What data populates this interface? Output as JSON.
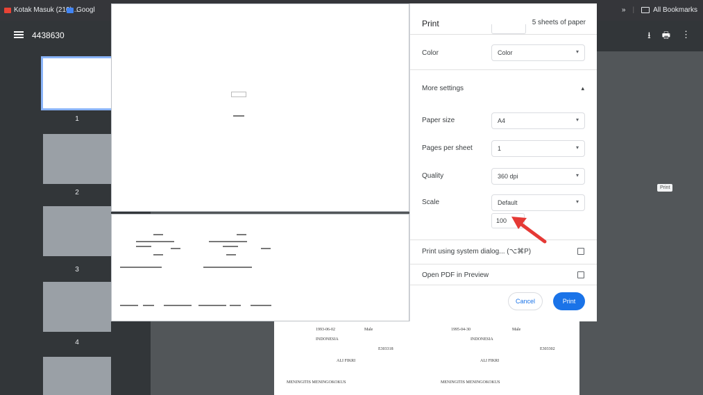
{
  "bookmarks": {
    "items": [
      {
        "label": "Kotak Masuk (210)...",
        "icon": "gmail-icon",
        "color": "#ea4335"
      },
      {
        "label": "Googl",
        "icon": "google-drive-icon",
        "color": "#4285f4"
      }
    ],
    "overflow": "»",
    "all_bookmarks": "All Bookmarks"
  },
  "pdf_viewer": {
    "title": "4438630",
    "menu_icon": "menu-icon",
    "actions": [
      "download-icon",
      "print-icon",
      "more-vert-icon"
    ],
    "thumbnails": [
      "1",
      "2",
      "3",
      "4"
    ],
    "background_print_label": "Print"
  },
  "print_dialog": {
    "title": "Print",
    "sheets": "5 sheets of paper",
    "color": {
      "label": "Color",
      "value": "Color"
    },
    "more_settings": "More settings",
    "paper_size": {
      "label": "Paper size",
      "value": "A4"
    },
    "pages_per_sheet": {
      "label": "Pages per sheet",
      "value": "1"
    },
    "quality": {
      "label": "Quality",
      "value": "360 dpi"
    },
    "scale": {
      "label": "Scale",
      "value": "Default",
      "custom": "100"
    },
    "system_dialog": "Print using system dialog... (⌥⌘P)",
    "open_pdf": "Open PDF in Preview",
    "cancel": "Cancel",
    "print": "Print"
  },
  "page_behind": {
    "texts": [
      "1993-06-02",
      "Male",
      "INDONESIA",
      "E303318",
      "ALI FIKRI",
      "MENINGITIS MENINGOKOKUS",
      "1995-04-30",
      "Male",
      "INDONESIA",
      "E303302",
      "ALI FIKRI",
      "MENINGITIS MENINGOKOKUS"
    ]
  },
  "colors": {
    "accent": "#1a73e8",
    "annotation": "#e53935"
  }
}
